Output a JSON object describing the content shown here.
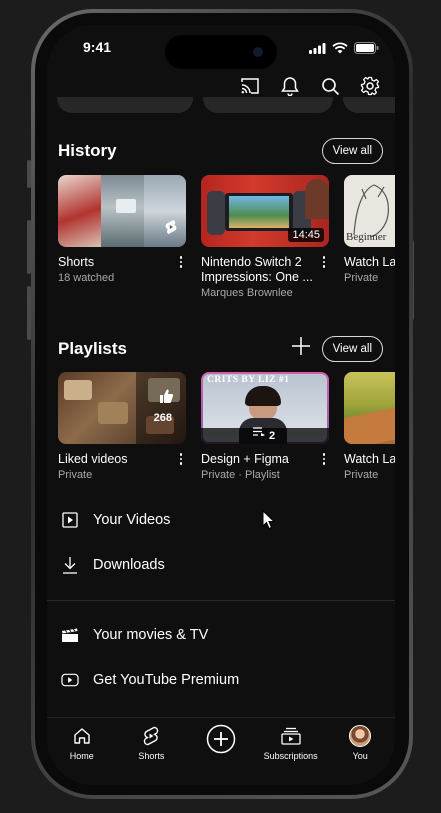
{
  "status": {
    "time": "9:41"
  },
  "history": {
    "title": "History",
    "view_all": "View all",
    "items": [
      {
        "title": "Shorts",
        "sub": "18 watched",
        "badge": ""
      },
      {
        "title": "Nintendo Switch 2 Impressions: One ...",
        "sub": "Marques Brownlee",
        "badge": "14:45"
      },
      {
        "title": "Watch La",
        "sub": "Private",
        "badge": ""
      }
    ]
  },
  "playlists": {
    "title": "Playlists",
    "view_all": "View all",
    "items": [
      {
        "title": "Liked videos",
        "sub": "Private",
        "badge": "268"
      },
      {
        "title": "Design + Figma",
        "sub": "Private · Playlist",
        "badge": "2",
        "thumb_caption": "CRITS BY LIZ #1"
      },
      {
        "title": "Watch La",
        "sub": "Private",
        "badge": ""
      }
    ]
  },
  "menu": {
    "your_videos": "Your Videos",
    "downloads": "Downloads",
    "movies_tv": "Your movies & TV",
    "premium": "Get YouTube Premium"
  },
  "bottom_nav": {
    "home": "Home",
    "shorts": "Shorts",
    "subscriptions": "Subscriptions",
    "you": "You"
  },
  "colors": {
    "background": "#0f0f0f",
    "accent": "#ff0000",
    "text": "#f1f1f1",
    "muted": "#aaaaaa"
  }
}
